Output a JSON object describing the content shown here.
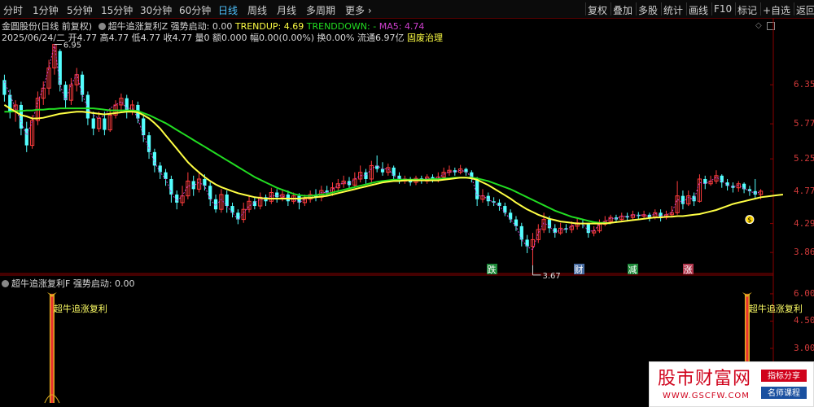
{
  "toolbar": {
    "periods": [
      "分时",
      "1分钟",
      "5分钟",
      "15分钟",
      "30分钟",
      "60分钟",
      "日线",
      "周线",
      "月线",
      "多周期",
      "更多"
    ],
    "active_index": 6,
    "right": [
      "复权",
      "叠加",
      "多股",
      "统计",
      "画线",
      "F10",
      "标记",
      "+自选",
      "返回"
    ]
  },
  "header": {
    "stock": "金圆股份(日线 前复权)",
    "indicator_name": "超牛追涨复利Z",
    "qiangshi_label": "强势启动:",
    "qiangshi_value": "0.00",
    "trendup_label": "TRENDUP:",
    "trendup_value": "4.69",
    "trenddown_label": "TRENDDOWN:",
    "trenddown_value": "-",
    "ma5_label": "MA5:",
    "ma5_value": "4.74",
    "ohlc_line": "2025/06/24/二 开4.77 高4.77 低4.77 收4.77",
    "vol_line": "量0 额0.000 幅0.00(0.00%) 换0.00% 流通6.97亿",
    "tag": "固废治理"
  },
  "sub_header": {
    "indicator_name": "超牛追涨复利F",
    "qiangshi_label": "强势启动:",
    "qiangshi_value": "0.00"
  },
  "colors": {
    "up": "#ff3c3c",
    "down": "#54ffff",
    "ma": "#ffff44",
    "trend": "#22dd22",
    "dash": "#d040d0",
    "axis": "#d23a3a"
  },
  "chart_data": [
    {
      "type": "candlestick",
      "y_ticks": [
        6.35,
        5.77,
        5.25,
        4.77,
        4.29,
        3.86
      ],
      "ylim": [
        3.62,
        6.98
      ],
      "high_annotation": "6.95",
      "low_annotation": "3.67",
      "markers": [
        "跌",
        "财",
        "减",
        "涨"
      ],
      "candles": [
        [
          6.42,
          6.2,
          6.5,
          6.1
        ],
        [
          6.2,
          5.95,
          6.28,
          5.85
        ],
        [
          5.95,
          6.05,
          6.12,
          5.8
        ],
        [
          6.05,
          5.7,
          6.1,
          5.6
        ],
        [
          5.7,
          5.45,
          5.8,
          5.35
        ],
        [
          5.45,
          5.82,
          5.9,
          5.4
        ],
        [
          5.82,
          6.15,
          6.25,
          5.75
        ],
        [
          6.15,
          6.3,
          6.4,
          6.05
        ],
        [
          6.3,
          6.6,
          6.72,
          6.2
        ],
        [
          6.6,
          6.95,
          6.95,
          6.5
        ],
        [
          6.85,
          6.35,
          6.88,
          6.25
        ],
        [
          6.35,
          6.12,
          6.4,
          6.0
        ],
        [
          6.12,
          6.35,
          6.45,
          6.05
        ],
        [
          6.35,
          6.5,
          6.6,
          6.25
        ],
        [
          6.5,
          6.2,
          6.55,
          6.1
        ],
        [
          6.2,
          5.85,
          6.25,
          5.75
        ],
        [
          5.85,
          5.7,
          5.95,
          5.6
        ],
        [
          5.7,
          5.85,
          5.95,
          5.65
        ],
        [
          5.85,
          5.68,
          5.95,
          5.6
        ],
        [
          5.68,
          5.9,
          6.0,
          5.65
        ],
        [
          5.9,
          6.05,
          6.12,
          5.85
        ],
        [
          6.05,
          6.15,
          6.22,
          5.95
        ],
        [
          6.15,
          5.95,
          6.2,
          5.85
        ],
        [
          5.95,
          6.05,
          6.12,
          5.9
        ],
        [
          6.05,
          5.85,
          6.1,
          5.78
        ],
        [
          5.85,
          5.6,
          5.9,
          5.5
        ],
        [
          5.6,
          5.35,
          5.65,
          5.25
        ],
        [
          5.35,
          5.15,
          5.4,
          5.05
        ],
        [
          5.15,
          5.05,
          5.2,
          4.95
        ],
        [
          5.05,
          4.95,
          5.1,
          4.85
        ],
        [
          4.95,
          4.72,
          5.0,
          4.6
        ],
        [
          4.72,
          4.6,
          4.78,
          4.5
        ],
        [
          4.6,
          4.7,
          4.85,
          4.55
        ],
        [
          4.7,
          4.92,
          5.05,
          4.65
        ],
        [
          4.92,
          4.8,
          5.0,
          4.7
        ],
        [
          4.8,
          4.95,
          5.05,
          4.75
        ],
        [
          4.95,
          4.85,
          5.02,
          4.78
        ],
        [
          4.85,
          4.65,
          4.9,
          4.55
        ],
        [
          4.65,
          4.5,
          4.72,
          4.45
        ],
        [
          4.5,
          4.72,
          4.8,
          4.45
        ],
        [
          4.72,
          4.55,
          4.78,
          4.45
        ],
        [
          4.55,
          4.45,
          4.6,
          4.38
        ],
        [
          4.45,
          4.35,
          4.5,
          4.28
        ],
        [
          4.35,
          4.5,
          4.6,
          4.3
        ],
        [
          4.5,
          4.62,
          4.7,
          4.45
        ],
        [
          4.62,
          4.55,
          4.68,
          4.5
        ],
        [
          4.55,
          4.68,
          4.75,
          4.5
        ],
        [
          4.68,
          4.62,
          4.72,
          4.55
        ],
        [
          4.62,
          4.75,
          4.82,
          4.58
        ],
        [
          4.75,
          4.68,
          4.8,
          4.6
        ],
        [
          4.68,
          4.72,
          4.8,
          4.62
        ],
        [
          4.72,
          4.62,
          4.78,
          4.55
        ],
        [
          4.62,
          4.7,
          4.75,
          4.58
        ],
        [
          4.7,
          4.6,
          4.74,
          4.5
        ],
        [
          4.6,
          4.65,
          4.72,
          4.55
        ],
        [
          4.65,
          4.72,
          4.78,
          4.6
        ],
        [
          4.72,
          4.68,
          4.8,
          4.62
        ],
        [
          4.68,
          4.78,
          4.85,
          4.62
        ],
        [
          4.78,
          4.75,
          4.85,
          4.7
        ],
        [
          4.75,
          4.82,
          4.9,
          4.7
        ],
        [
          4.82,
          4.88,
          4.95,
          4.78
        ],
        [
          4.88,
          4.92,
          5.0,
          4.82
        ],
        [
          4.92,
          4.86,
          4.98,
          4.8
        ],
        [
          4.86,
          4.95,
          5.05,
          4.82
        ],
        [
          4.95,
          5.05,
          5.15,
          4.9
        ],
        [
          5.05,
          4.95,
          5.1,
          4.88
        ],
        [
          4.95,
          5.15,
          5.22,
          4.9
        ],
        [
          5.15,
          5.1,
          5.3,
          5.05
        ],
        [
          5.1,
          5.05,
          5.2,
          5.0
        ],
        [
          5.05,
          5.12,
          5.18,
          5.0
        ],
        [
          5.12,
          5.0,
          5.15,
          4.95
        ],
        [
          5.0,
          4.92,
          5.05,
          4.88
        ],
        [
          4.92,
          4.95,
          5.0,
          4.88
        ],
        [
          4.95,
          4.9,
          4.98,
          4.85
        ],
        [
          4.9,
          4.96,
          5.0,
          4.86
        ],
        [
          4.96,
          4.92,
          5.0,
          4.88
        ],
        [
          4.92,
          4.98,
          5.02,
          4.88
        ],
        [
          4.98,
          4.94,
          5.02,
          4.9
        ],
        [
          4.94,
          4.98,
          5.05,
          4.9
        ],
        [
          4.98,
          5.05,
          5.12,
          4.95
        ],
        [
          5.05,
          5.08,
          5.15,
          5.0
        ],
        [
          5.08,
          5.05,
          5.12,
          5.0
        ],
        [
          5.05,
          5.1,
          5.16,
          5.02
        ],
        [
          5.1,
          5.05,
          5.12,
          5.0
        ],
        [
          5.05,
          4.95,
          5.08,
          4.9
        ],
        [
          4.95,
          4.65,
          4.98,
          4.55
        ],
        [
          4.65,
          4.7,
          4.8,
          4.6
        ],
        [
          4.7,
          4.62,
          4.75,
          4.55
        ],
        [
          4.62,
          4.6,
          4.68,
          4.55
        ],
        [
          4.6,
          4.55,
          4.65,
          4.48
        ],
        [
          4.55,
          4.45,
          4.6,
          4.4
        ],
        [
          4.45,
          4.35,
          4.5,
          4.3
        ],
        [
          4.35,
          4.25,
          4.4,
          4.18
        ],
        [
          4.25,
          4.05,
          4.3,
          3.95
        ],
        [
          4.05,
          3.95,
          4.12,
          3.85
        ],
        [
          3.95,
          4.05,
          4.15,
          3.67
        ],
        [
          4.05,
          4.2,
          4.28,
          4.0
        ],
        [
          4.2,
          4.35,
          4.45,
          4.15
        ],
        [
          4.35,
          4.22,
          4.4,
          4.15
        ],
        [
          4.22,
          4.15,
          4.28,
          4.08
        ],
        [
          4.15,
          4.22,
          4.3,
          4.12
        ],
        [
          4.22,
          4.2,
          4.28,
          4.15
        ],
        [
          4.2,
          4.25,
          4.32,
          4.15
        ],
        [
          4.25,
          4.3,
          4.38,
          4.2
        ],
        [
          4.3,
          4.28,
          4.35,
          4.22
        ],
        [
          4.28,
          4.15,
          4.3,
          4.08
        ],
        [
          4.15,
          4.18,
          4.25,
          4.1
        ],
        [
          4.18,
          4.28,
          4.35,
          4.15
        ],
        [
          4.28,
          4.32,
          4.4,
          4.25
        ],
        [
          4.32,
          4.38,
          4.42,
          4.28
        ],
        [
          4.38,
          4.35,
          4.42,
          4.3
        ],
        [
          4.35,
          4.4,
          4.45,
          4.32
        ],
        [
          4.4,
          4.38,
          4.45,
          4.32
        ],
        [
          4.38,
          4.42,
          4.48,
          4.35
        ],
        [
          4.42,
          4.4,
          4.46,
          4.35
        ],
        [
          4.4,
          4.42,
          4.48,
          4.36
        ],
        [
          4.42,
          4.38,
          4.45,
          4.32
        ],
        [
          4.38,
          4.45,
          4.5,
          4.35
        ],
        [
          4.45,
          4.38,
          4.5,
          4.32
        ],
        [
          4.38,
          4.42,
          4.48,
          4.35
        ],
        [
          4.42,
          4.45,
          4.55,
          4.4
        ],
        [
          4.45,
          4.7,
          4.92,
          4.42
        ],
        [
          4.7,
          4.58,
          4.78,
          4.5
        ],
        [
          4.58,
          4.7,
          4.78,
          4.55
        ],
        [
          4.7,
          4.62,
          4.75,
          4.55
        ],
        [
          4.62,
          4.95,
          5.02,
          4.6
        ],
        [
          4.95,
          4.88,
          5.0,
          4.8
        ],
        [
          4.88,
          4.92,
          5.0,
          4.85
        ],
        [
          4.92,
          5.0,
          5.08,
          4.88
        ],
        [
          5.0,
          4.9,
          5.02,
          4.82
        ],
        [
          4.9,
          4.85,
          4.95,
          4.78
        ],
        [
          4.85,
          4.82,
          4.9,
          4.75
        ],
        [
          4.82,
          4.88,
          4.92,
          4.76
        ],
        [
          4.88,
          4.8,
          4.9,
          4.74
        ],
        [
          4.8,
          4.77,
          4.85,
          4.7
        ],
        [
          4.77,
          4.72,
          4.95,
          4.65
        ],
        [
          4.72,
          4.77,
          4.8,
          4.65
        ]
      ],
      "ma_line": [
        6.05,
        6.0,
        5.95,
        5.9,
        5.88,
        5.85,
        5.85,
        5.86,
        5.88,
        5.9,
        5.92,
        5.93,
        5.94,
        5.95,
        5.95,
        5.94,
        5.93,
        5.92,
        5.91,
        5.92,
        5.93,
        5.94,
        5.95,
        5.95,
        5.94,
        5.9,
        5.85,
        5.78,
        5.7,
        5.6,
        5.5,
        5.4,
        5.3,
        5.2,
        5.12,
        5.05,
        4.98,
        4.92,
        4.87,
        4.83,
        4.8,
        4.77,
        4.74,
        4.72,
        4.7,
        4.68,
        4.67,
        4.66,
        4.66,
        4.66,
        4.66,
        4.66,
        4.66,
        4.66,
        4.67,
        4.67,
        4.68,
        4.69,
        4.7,
        4.72,
        4.74,
        4.76,
        4.78,
        4.8,
        4.82,
        4.84,
        4.86,
        4.88,
        4.9,
        4.91,
        4.92,
        4.92,
        4.93,
        4.93,
        4.93,
        4.93,
        4.93,
        4.93,
        4.93,
        4.94,
        4.95,
        4.96,
        4.97,
        4.97,
        4.96,
        4.94,
        4.9,
        4.86,
        4.81,
        4.76,
        4.71,
        4.66,
        4.6,
        4.55,
        4.5,
        4.46,
        4.42,
        4.39,
        4.36,
        4.34,
        4.32,
        4.31,
        4.3,
        4.29,
        4.29,
        4.29,
        4.29,
        4.29,
        4.29,
        4.3,
        4.31,
        4.32,
        4.33,
        4.34,
        4.35,
        4.36,
        4.37,
        4.38,
        4.38,
        4.39,
        4.39,
        4.4,
        4.4,
        4.41,
        4.42,
        4.43,
        4.45,
        4.47,
        4.49,
        4.52,
        4.55,
        4.58,
        4.6,
        4.62,
        4.64,
        4.66,
        4.68,
        4.69,
        4.7,
        4.71,
        4.72
      ],
      "trend_line": [
        5.95,
        5.95,
        5.96,
        5.96,
        5.97,
        5.97,
        5.98,
        5.98,
        5.99,
        5.99,
        6.0,
        6.0,
        6.0,
        6.0,
        6.0,
        6.0,
        6.0,
        5.99,
        5.98,
        5.97,
        5.97,
        5.97,
        5.97,
        5.97,
        5.96,
        5.93,
        5.9,
        5.86,
        5.82,
        5.78,
        5.73,
        5.68,
        5.63,
        5.58,
        5.53,
        5.48,
        5.43,
        5.38,
        5.33,
        5.28,
        5.23,
        5.18,
        5.13,
        5.08,
        5.03,
        4.98,
        4.94,
        4.9,
        4.86,
        4.82,
        4.79,
        4.76,
        4.73,
        4.71,
        4.7,
        4.7,
        4.71,
        4.72,
        4.73,
        4.75,
        4.77,
        4.79,
        4.81,
        4.83,
        4.85,
        4.87,
        4.89,
        4.91,
        4.92,
        4.93,
        4.94,
        4.94,
        4.94,
        4.94,
        4.94,
        4.94,
        4.94,
        4.95,
        4.95,
        4.96,
        4.96,
        4.97,
        4.97,
        4.97,
        4.97,
        4.96,
        4.94,
        4.92,
        4.89,
        4.86,
        4.83,
        4.8,
        4.76,
        4.72,
        4.68,
        4.64,
        4.6,
        4.56,
        4.52,
        4.48,
        4.45,
        4.42,
        4.39,
        4.37,
        4.35,
        4.33,
        4.31,
        4.3,
        4.3,
        4.29,
        null,
        null,
        null,
        null,
        null,
        null,
        null,
        null,
        null,
        null,
        null,
        null,
        null,
        null,
        null,
        null,
        null,
        null,
        null,
        null,
        null,
        null,
        null,
        null,
        null,
        null,
        null,
        null,
        null,
        null
      ],
      "dash_line": [
        6.4,
        6.2,
        6.0,
        5.8,
        5.6,
        5.8,
        6.1,
        6.3,
        6.6,
        6.95,
        6.35,
        6.12,
        6.35,
        6.5,
        6.2,
        6.0,
        5.9,
        5.85,
        5.9,
        6.0,
        6.05,
        6.1,
        6.0,
        6.0,
        5.85,
        5.6,
        5.4,
        5.2,
        5.05,
        4.95,
        4.75,
        4.62,
        4.7,
        4.85,
        4.85,
        4.9,
        4.85,
        4.65,
        4.55,
        4.65,
        4.55,
        4.45,
        4.35,
        4.45,
        4.55,
        4.6,
        4.65,
        4.65,
        4.7,
        4.7,
        4.7,
        4.65,
        4.65,
        4.6,
        4.65,
        4.7,
        4.7,
        4.75,
        4.75,
        4.8,
        4.85,
        4.9,
        4.88,
        4.95,
        5.0,
        5.0,
        5.1,
        5.15,
        5.1,
        5.1,
        5.0,
        4.95,
        4.95,
        4.92,
        4.95,
        4.94,
        4.96,
        4.95,
        4.97,
        5.02,
        5.06,
        5.06,
        5.08,
        5.06,
        4.98,
        4.7,
        4.7,
        4.65,
        4.6,
        4.55,
        4.45,
        4.35,
        4.25,
        4.05,
        3.95,
        3.9,
        4.15,
        4.3,
        4.25,
        4.15,
        4.2,
        4.2,
        4.25,
        4.3,
        4.28,
        4.18,
        4.18,
        4.28,
        4.32,
        4.37,
        4.36,
        4.4,
        4.39,
        4.42,
        4.41,
        4.42,
        4.39,
        4.44,
        4.4,
        4.42,
        4.45,
        4.65,
        4.6,
        4.68,
        4.64,
        4.9,
        4.88,
        4.92,
        4.98,
        4.92,
        4.86,
        4.83,
        4.86,
        4.81,
        4.77,
        4.74,
        4.76
      ]
    },
    {
      "type": "bar",
      "y_ticks": [
        6.0,
        4.5,
        3.0
      ],
      "ylim": [
        0,
        6.4
      ],
      "signal_label": "超牛追涨复利",
      "signals": [
        {
          "index": 9,
          "value": 6.0
        },
        {
          "index": 134,
          "value": 6.0
        }
      ]
    }
  ],
  "watermark": {
    "big": "股市财富网",
    "url": "WWW.GSCFW.COM",
    "badge1": "指标分享",
    "badge2": "名师课程"
  }
}
